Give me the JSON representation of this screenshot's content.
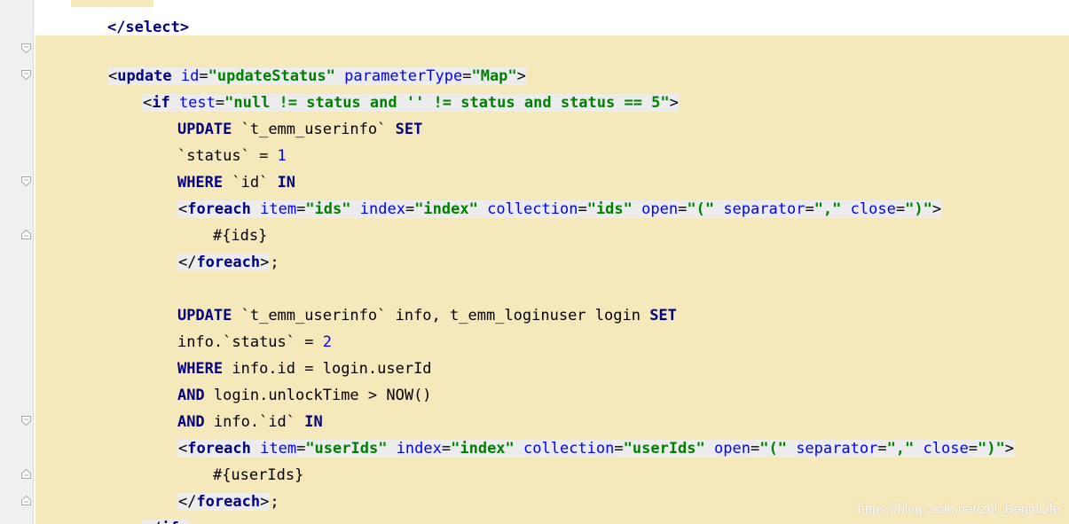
{
  "code": {
    "partial_top_line": "</select>",
    "lines": [
      {
        "open_lt": "<",
        "tag": "update",
        "attrs": [
          {
            "name": "id",
            "eq": "=",
            "value": "\"updateStatus\""
          },
          {
            "name": "parameterType",
            "eq": "=",
            "value": "\"Map\""
          }
        ],
        "close_gt": ">"
      },
      {
        "open_lt": "<",
        "tag": "if",
        "attrs": [
          {
            "name": "test",
            "eq": "=",
            "value": "\"null != status and '' != status and status == 5\""
          }
        ],
        "close_gt": ">"
      },
      {
        "kw1": "UPDATE",
        "text1": " `t_emm_userinfo` ",
        "kw2": "SET"
      },
      {
        "text1": "`status` = ",
        "num": "1"
      },
      {
        "kw1": "WHERE",
        "text1": " `id` ",
        "kw2": "IN"
      },
      {
        "open_lt": "<",
        "tag": "foreach",
        "attrs": [
          {
            "name": "item",
            "eq": "=",
            "value": "\"ids\""
          },
          {
            "name": "index",
            "eq": "=",
            "value": "\"index\""
          },
          {
            "name": "collection",
            "eq": "=",
            "value": "\"ids\""
          },
          {
            "name": "open",
            "eq": "=",
            "value": "\"(\""
          },
          {
            "name": "separator",
            "eq": "=",
            "value": "\",\""
          },
          {
            "name": "close",
            "eq": "=",
            "value": "\")\""
          }
        ],
        "close_gt": ">"
      },
      {
        "text1": "#{ids}"
      },
      {
        "close_open": "</",
        "tag": "foreach",
        "close_gt": ">",
        "tail": ";"
      },
      {
        "text1": ""
      },
      {
        "kw1": "UPDATE",
        "text1": " `t_emm_userinfo` info, t_emm_loginuser login ",
        "kw2": "SET"
      },
      {
        "text1": "info.`status` = ",
        "num": "2"
      },
      {
        "kw1": "WHERE",
        "text1": " info.id = login.userId"
      },
      {
        "kw1": "AND",
        "text1": " login.unlockTime > NOW()"
      },
      {
        "kw1": "AND",
        "text1": " info.`id` ",
        "kw2": "IN"
      },
      {
        "open_lt": "<",
        "tag": "foreach",
        "attrs": [
          {
            "name": "item",
            "eq": "=",
            "value": "\"userIds\""
          },
          {
            "name": "index",
            "eq": "=",
            "value": "\"index\""
          },
          {
            "name": "collection",
            "eq": "=",
            "value": "\"userIds\""
          },
          {
            "name": "open",
            "eq": "=",
            "value": "\"(\""
          },
          {
            "name": "separator",
            "eq": "=",
            "value": "\",\""
          },
          {
            "name": "close",
            "eq": "=",
            "value": "\")\""
          }
        ],
        "close_gt": ">"
      },
      {
        "text1": "#{userIds}"
      },
      {
        "close_open": "</",
        "tag": "foreach",
        "close_gt": ">",
        "tail": ";"
      },
      {
        "close_open": "</",
        "tag": "if",
        "close_gt": ">"
      }
    ]
  },
  "watermark": "https://blog.csdn.net/zhl_BeginLife",
  "colors": {
    "highlight": "#f5e9bc",
    "tag": "#000080",
    "attribute": "#0000ff",
    "value": "#008000",
    "keyword": "#000080",
    "number": "#0000ff"
  }
}
